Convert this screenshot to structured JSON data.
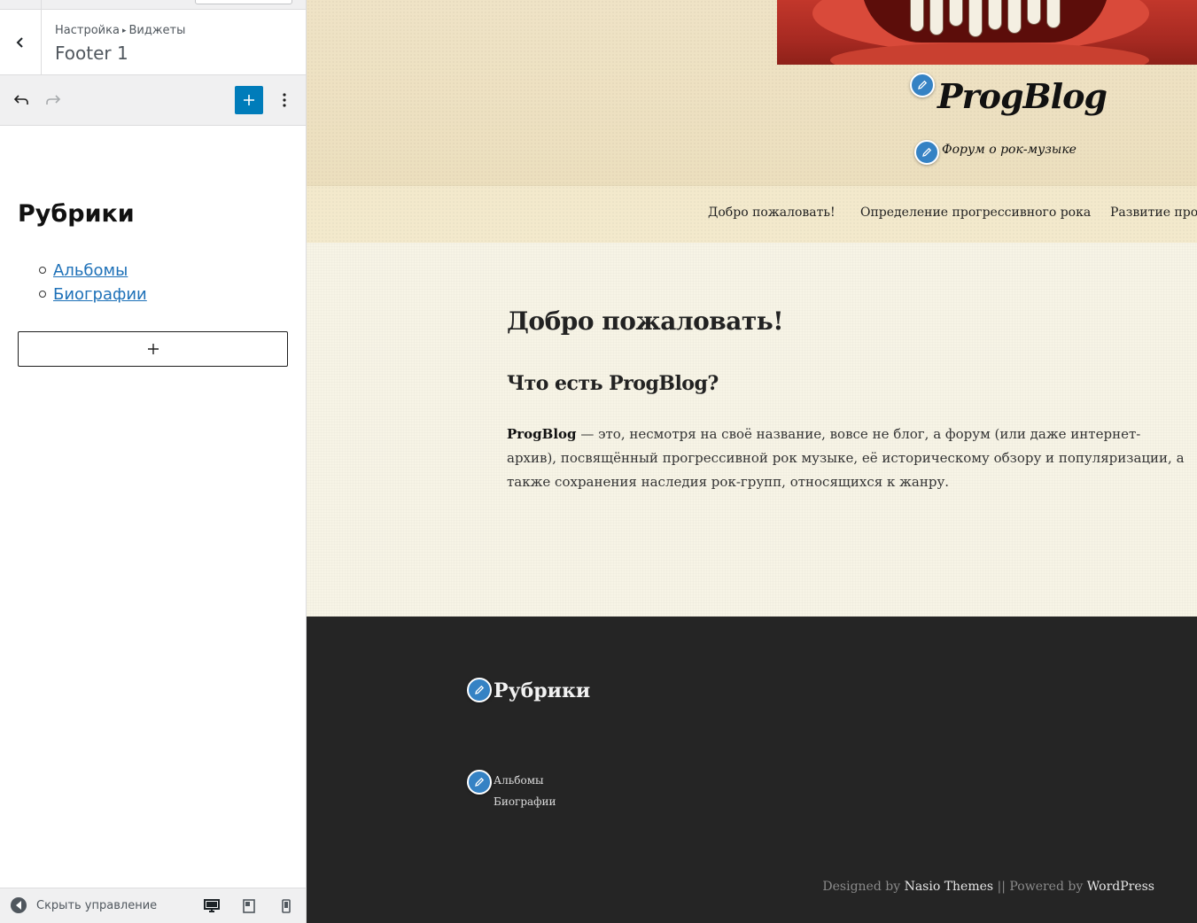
{
  "sidebar": {
    "breadcrumb": {
      "parent": "Настройка",
      "arrow": "▸",
      "current": "Виджеты"
    },
    "section_title": "Footer 1",
    "editor": {
      "widget_heading": "Рубрики",
      "categories": [
        "Альбомы",
        "Биографии"
      ],
      "add_block_symbol": "+"
    },
    "footer": {
      "collapse_label": "Скрыть управление"
    }
  },
  "preview": {
    "site_title": "ProgBlog",
    "site_description": "Форум о рок-музыке",
    "nav": [
      "Добро пожаловать!",
      "Определение прогрессивного рока",
      "Развитие прог"
    ],
    "post": {
      "title": "Добро пожаловать!",
      "subtitle": "Что есть ProgBlog?",
      "body_bold": "ProgBlog",
      "body_rest": " — это, несмотря на своё название, вовсе не блог, а форум (или даже интернет-архив), посвящённый прогрессивной рок музыке, её историческому обзору и популяризации, а также сохранения наследия рок-групп, относящихся к жанру."
    },
    "footer": {
      "widget_heading": "Рубрики",
      "categories": [
        "Альбомы",
        "Биографии"
      ],
      "credits": {
        "designed_by": "Designed by ",
        "designer": "Nasio Themes",
        "separator": " || Powered by ",
        "platform": "WordPress"
      }
    }
  },
  "colors": {
    "accent": "#007cba",
    "edit_pin": "#3582c4",
    "link": "#1e71b8",
    "footer_bg": "#252525",
    "header_bg": "#eee2c4"
  },
  "icons": [
    "chevron-left-icon",
    "undo-icon",
    "redo-icon",
    "plus-icon",
    "more-vertical-icon",
    "pencil-icon",
    "collapse-icon",
    "desktop-icon",
    "tablet-icon",
    "mobile-icon"
  ]
}
